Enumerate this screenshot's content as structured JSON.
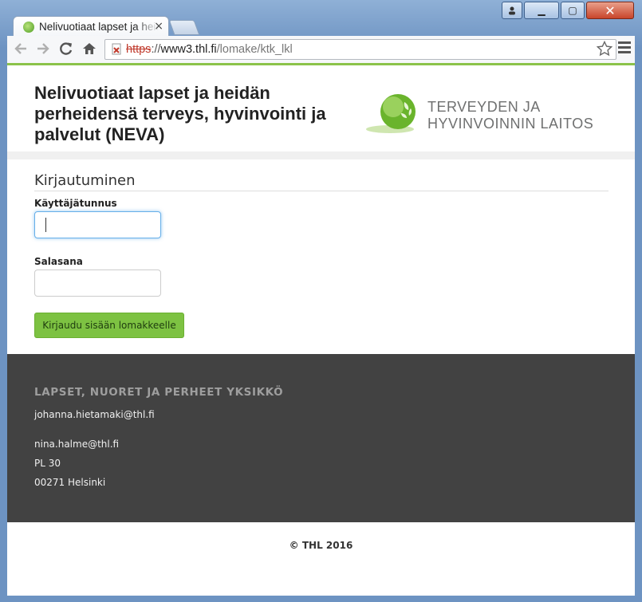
{
  "browser": {
    "tab_title": "Nelivuotiaat lapset ja heidän",
    "tab_close": "×",
    "url_scheme": "https",
    "url_sep": "://",
    "url_host": "www3.thl.fi",
    "url_path": "/lomake/ktk_lkl",
    "icons": {
      "back": "back-arrow-icon",
      "forward": "forward-arrow-icon",
      "reload": "reload-icon",
      "home": "home-icon",
      "star": "bookmark-star-icon",
      "menu": "hamburger-menu-icon"
    },
    "accent_color": "#8bc34a"
  },
  "window_controls": {
    "minimize": "▁",
    "maximize": "▢",
    "close": "✕"
  },
  "header": {
    "site_title": "Nelivuotiaat lapset ja heidän perheidensä terveys, hyvinvointi ja palvelut (NEVA)",
    "logo_line1": "TERVEYDEN JA",
    "logo_line2": "HYVINVOINNIN LAITOS"
  },
  "login": {
    "heading": "Kirjautuminen",
    "username_label": "Käyttäjätunnus",
    "username_value": "",
    "password_label": "Salasana",
    "password_value": "",
    "submit_label": "Kirjaudu sisään lomakkeelle",
    "button_color": "#7dc242"
  },
  "footer": {
    "title": "LAPSET, NUORET JA PERHEET YKSIKKÖ",
    "email1": "johanna.hietamaki@thl.fi",
    "email2": "nina.halme@thl.fi",
    "po_box": "PL 30",
    "postal": "00271 Helsinki",
    "background_color": "#424242"
  },
  "copyright": "© THL 2016"
}
